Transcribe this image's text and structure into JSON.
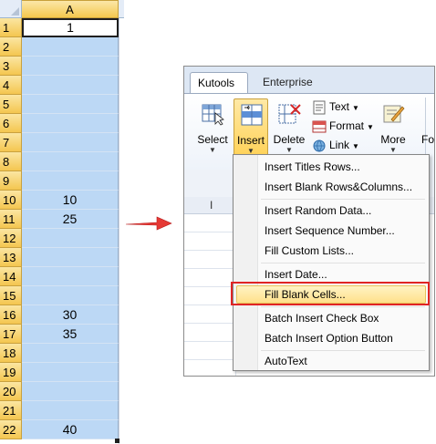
{
  "sheet": {
    "column_header": "A",
    "rows": [
      {
        "num": "1",
        "value": "1"
      },
      {
        "num": "2",
        "value": ""
      },
      {
        "num": "3",
        "value": ""
      },
      {
        "num": "4",
        "value": ""
      },
      {
        "num": "5",
        "value": ""
      },
      {
        "num": "6",
        "value": ""
      },
      {
        "num": "7",
        "value": ""
      },
      {
        "num": "8",
        "value": ""
      },
      {
        "num": "9",
        "value": ""
      },
      {
        "num": "10",
        "value": "10"
      },
      {
        "num": "11",
        "value": "25"
      },
      {
        "num": "12",
        "value": ""
      },
      {
        "num": "13",
        "value": ""
      },
      {
        "num": "14",
        "value": ""
      },
      {
        "num": "15",
        "value": ""
      },
      {
        "num": "16",
        "value": "30"
      },
      {
        "num": "17",
        "value": "35"
      },
      {
        "num": "18",
        "value": ""
      },
      {
        "num": "19",
        "value": ""
      },
      {
        "num": "20",
        "value": ""
      },
      {
        "num": "21",
        "value": ""
      },
      {
        "num": "22",
        "value": "40"
      }
    ],
    "selected_fill": "#bcd8f5"
  },
  "ribbon": {
    "tabs": {
      "kutools": "Kutools",
      "enterprise": "Enterprise"
    },
    "buttons": {
      "select": "Select",
      "insert": "Insert",
      "delete": "Delete",
      "more": "More",
      "edge": "Fo"
    },
    "small_buttons": {
      "text": "Text",
      "format": "Format",
      "link": "Link"
    },
    "dropdown_arrow": "▼",
    "column_label": "I"
  },
  "menu": {
    "items": [
      "Insert Titles Rows...",
      "Insert Blank Rows&Columns...",
      "Insert Random Data...",
      "Insert Sequence Number...",
      "Fill Custom Lists...",
      "Insert Date...",
      "Fill Blank Cells...",
      "Batch Insert Check Box",
      "Batch Insert Option Button",
      "AutoText"
    ],
    "highlighted": "Fill Blank Cells..."
  },
  "colors": {
    "arrow": "#e53935",
    "highlight_border": "#e02424",
    "header_gold": "#f4c84f"
  }
}
